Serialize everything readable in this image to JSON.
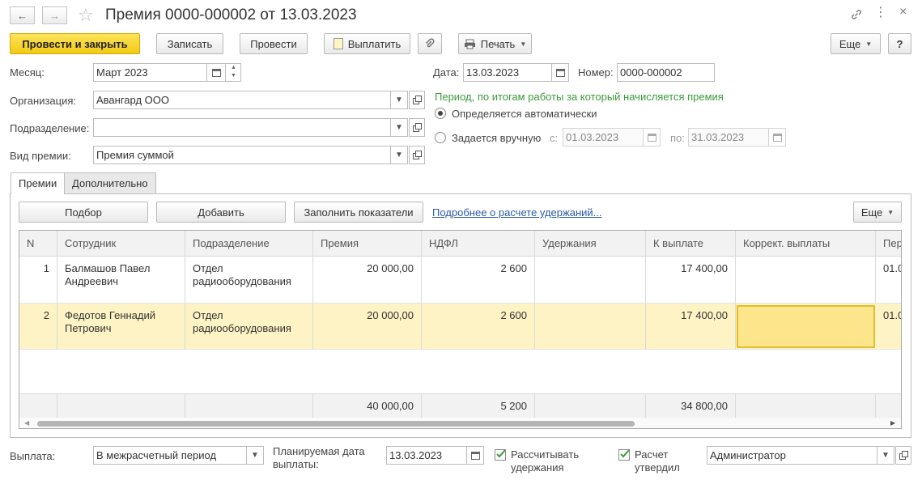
{
  "window": {
    "title": "Премия 0000-000002 от 13.03.2023"
  },
  "toolbar": {
    "post_close": "Провести и закрыть",
    "save": "Записать",
    "post": "Провести",
    "pay": "Выплатить",
    "print": "Печать",
    "more": "Еще",
    "help": "?"
  },
  "form": {
    "month_label": "Месяц:",
    "month_value": "Март 2023",
    "date_label": "Дата:",
    "date_value": "13.03.2023",
    "number_label": "Номер:",
    "number_value": "0000-000002",
    "org_label": "Организация:",
    "org_value": "Авангард ООО",
    "dept_label": "Подразделение:",
    "dept_value": "",
    "bonus_type_label": "Вид премии:",
    "bonus_type_value": "Премия суммой",
    "period_hint": "Период, по итогам работы за который начисляется премия",
    "radio_auto": "Определяется автоматически",
    "radio_manual": "Задается вручную",
    "from_label": "с:",
    "from_value": "01.03.2023",
    "to_label": "по:",
    "to_value": "31.03.2023"
  },
  "tabs": [
    {
      "label": "Премии",
      "active": true
    },
    {
      "label": "Дополнительно",
      "active": false
    }
  ],
  "panel": {
    "select_btn": "Подбор",
    "add_btn": "Добавить",
    "fill_btn": "Заполнить показатели",
    "details_link": "Подробнее о расчете удержаний...",
    "more_btn": "Еще"
  },
  "table": {
    "headers": [
      "N",
      "Сотрудник",
      "Подразделение",
      "Премия",
      "НДФЛ",
      "Удержания",
      "К выплате",
      "Коррект. выплаты",
      "Пер"
    ],
    "rows": [
      {
        "n": "1",
        "employee": "Балмашов Павел Андреевич",
        "dept": "Отдел радиооборудования",
        "bonus": "20 000,00",
        "ndfl": "2 600",
        "deductions": "",
        "payout": "17 400,00",
        "correction": "",
        "period": "01.0"
      },
      {
        "n": "2",
        "employee": "Федотов Геннадий Петрович",
        "dept": "Отдел радиооборудования",
        "bonus": "20 000,00",
        "ndfl": "2 600",
        "deductions": "",
        "payout": "17 400,00",
        "correction": "",
        "period": "01.0"
      }
    ],
    "totals": {
      "bonus": "40 000,00",
      "ndfl": "5 200",
      "payout": "34 800,00"
    }
  },
  "footer": {
    "payment_label": "Выплата:",
    "payment_value": "В межрасчетный период",
    "planned_date_label": "Планируемая дата выплаты:",
    "planned_date_value": "13.03.2023",
    "calc_deductions_label": "Рассчитывать удержания",
    "calc_approved_label": "Расчет утвердил",
    "approver_value": "Администратор"
  },
  "colors": {
    "primary_button": "#f3c914",
    "selected_row": "#fdf3c4",
    "selected_cell": "#fce58b",
    "hint_green": "#3a9a3a",
    "link_blue": "#2a5aa8"
  }
}
